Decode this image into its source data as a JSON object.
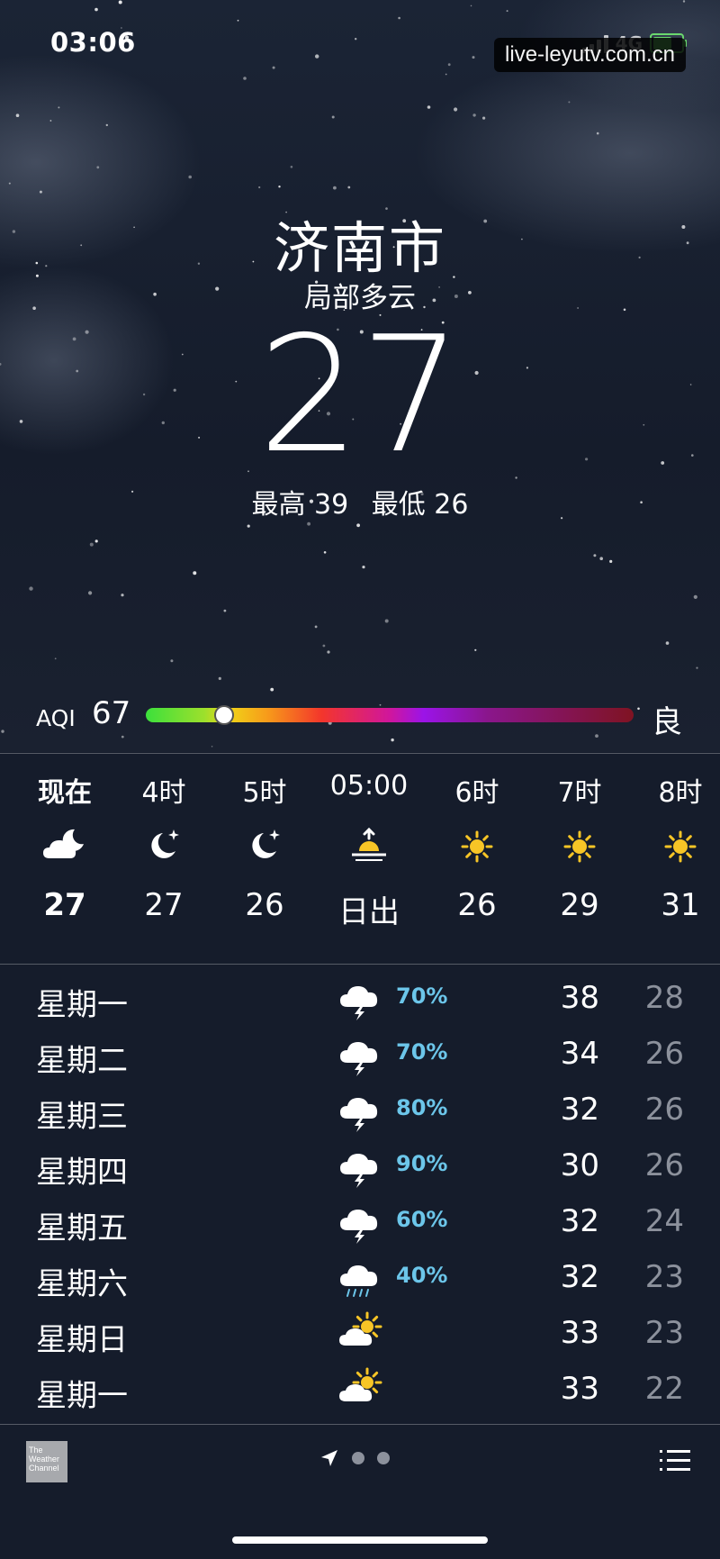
{
  "status_bar": {
    "time": "03:06",
    "network": "4G"
  },
  "watermark": "live-leyutv.com.cn",
  "location": {
    "city": "济南市",
    "condition": "局部多云",
    "temperature": "27",
    "high": "最高 39",
    "low": "最低 26"
  },
  "aqi": {
    "label": "AQI",
    "value": "67",
    "level": "良",
    "fraction": 0.16
  },
  "hourly": [
    {
      "label": "现在",
      "icon": "cloudy-moon-icon",
      "temp": "27"
    },
    {
      "label": "4时",
      "icon": "moon-stars-icon",
      "temp": "27"
    },
    {
      "label": "5时",
      "icon": "moon-stars-icon",
      "temp": "26"
    },
    {
      "label": "05:00",
      "icon": "sunrise-icon",
      "temp": "日出"
    },
    {
      "label": "6时",
      "icon": "sun-icon",
      "temp": "26"
    },
    {
      "label": "7时",
      "icon": "sun-icon",
      "temp": "29"
    },
    {
      "label": "8时",
      "icon": "sun-icon",
      "temp": "31"
    }
  ],
  "daily": [
    {
      "day": "星期一",
      "icon": "thunderstorm-icon",
      "precip": "70%",
      "high": "38",
      "low": "28"
    },
    {
      "day": "星期二",
      "icon": "thunderstorm-icon",
      "precip": "70%",
      "high": "34",
      "low": "26"
    },
    {
      "day": "星期三",
      "icon": "thunderstorm-icon",
      "precip": "80%",
      "high": "32",
      "low": "26"
    },
    {
      "day": "星期四",
      "icon": "thunderstorm-icon",
      "precip": "90%",
      "high": "30",
      "low": "26"
    },
    {
      "day": "星期五",
      "icon": "thunderstorm-icon",
      "precip": "60%",
      "high": "32",
      "low": "24"
    },
    {
      "day": "星期六",
      "icon": "rain-icon",
      "precip": "40%",
      "high": "32",
      "low": "23"
    },
    {
      "day": "星期日",
      "icon": "partly-sunny-icon",
      "precip": "",
      "high": "33",
      "low": "23"
    },
    {
      "day": "星期一",
      "icon": "partly-sunny-icon",
      "precip": "",
      "high": "33",
      "low": "22"
    }
  ],
  "footer": {
    "logo_text": "The Weather Channel"
  },
  "colors": {
    "sun": "#f7c526",
    "precip": "#6cc6ea",
    "low_temp": "#8c919c"
  }
}
